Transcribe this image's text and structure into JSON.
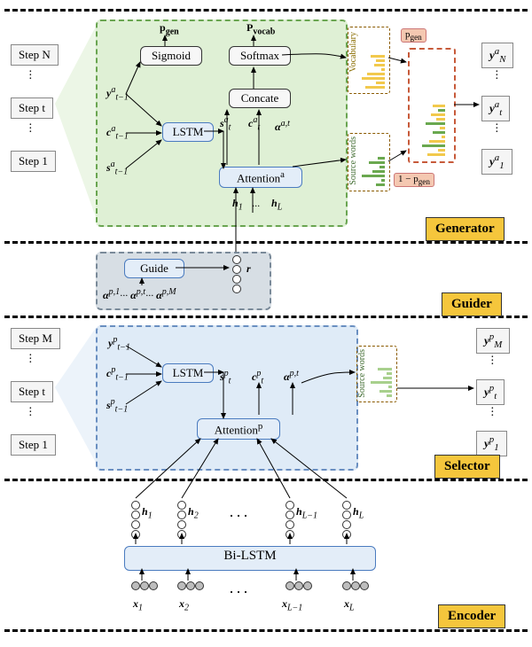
{
  "modules": {
    "generator": "Generator",
    "guider": "Guider",
    "selector": "Selector",
    "encoder": "Encoder"
  },
  "generator": {
    "steps": {
      "n": "Step N",
      "t": "Step t",
      "1": "Step 1"
    },
    "pgen": "p",
    "pgen_sub": "gen",
    "pvocab": "P",
    "pvocab_sub": "vocab",
    "sigmoid": "Sigmoid",
    "softmax": "Softmax",
    "concate": "Concate",
    "lstm": "LSTM",
    "attention": "Attention",
    "attn_sup": "a",
    "y_prev": "y",
    "y_prev_sub": "t−1",
    "y_prev_sup": "a",
    "c_prev": "c",
    "c_prev_sub": "t−1",
    "c_prev_sup": "a",
    "s_prev": "s",
    "s_prev_sub": "t−1",
    "s_prev_sup": "a",
    "s_t": "s",
    "s_t_sub": "t",
    "s_t_sup": "a",
    "c_t": "c",
    "c_t_sub": "t",
    "c_t_sup": "a",
    "alpha": "α",
    "alpha_sup": "a,t",
    "h1": "h",
    "h1_sub": "1",
    "hL": "h",
    "hL_sub": "L",
    "mid_dots": "···",
    "outputs": {
      "yN": "y",
      "yN_sub": "N",
      "yN_sup": "a",
      "yt": "y",
      "yt_sub": "t",
      "yt_sup": "a",
      "y1": "y",
      "y1_sub": "1",
      "y1_sup": "a"
    },
    "vocab_label": "Vocabulary",
    "source_label": "Source words",
    "pgen_box": "p",
    "pgen_box_sub": "gen",
    "one_minus": "1 − p",
    "one_minus_sub": "gen"
  },
  "guider": {
    "guide_label": "Guide",
    "r": "r",
    "sequence": {
      "a1": "α",
      "a1_sup": "p,1",
      "at": "α",
      "at_sup": "p,t",
      "aM": "α",
      "aM_sup": "p,M"
    }
  },
  "selector": {
    "steps": {
      "m": "Step M",
      "t": "Step t",
      "1": "Step 1"
    },
    "lstm": "LSTM",
    "attention": "Attention",
    "attn_sup": "p",
    "y_prev": "y",
    "y_prev_sub": "t−1",
    "y_prev_sup": "p",
    "c_prev": "c",
    "c_prev_sub": "t−1",
    "c_prev_sup": "p",
    "s_prev": "s",
    "s_prev_sub": "t−1",
    "s_prev_sup": "p",
    "s_t": "s",
    "s_t_sub": "t",
    "s_t_sup": "p",
    "c_t": "c",
    "c_t_sub": "t",
    "c_t_sup": "p",
    "alpha": "α",
    "alpha_sup": "p,t",
    "source_label": "Source words",
    "outputs": {
      "yM": "y",
      "yM_sub": "M",
      "yM_sup": "p",
      "yt": "y",
      "yt_sub": "t",
      "yt_sup": "p",
      "y1": "y",
      "y1_sub": "1",
      "y1_sup": "p"
    }
  },
  "encoder": {
    "bilstm": "Bi-LSTM",
    "x1": "x",
    "x1_sub": "1",
    "x2": "x",
    "x2_sub": "2",
    "xLm1": "x",
    "xLm1_sub": "L−1",
    "xL": "x",
    "xL_sub": "L",
    "h1": "h",
    "h1_sub": "1",
    "h2": "h",
    "h2_sub": "2",
    "hLm1": "h",
    "hLm1_sub": "L−1",
    "hL": "h",
    "hL_sub": "L",
    "dots": "···"
  },
  "colors": {
    "vocab_bar": "#f2c94c",
    "source_bar": "#6aa84f",
    "mix_bar_a": "#f2c94c",
    "mix_bar_b": "#6aa84f"
  }
}
